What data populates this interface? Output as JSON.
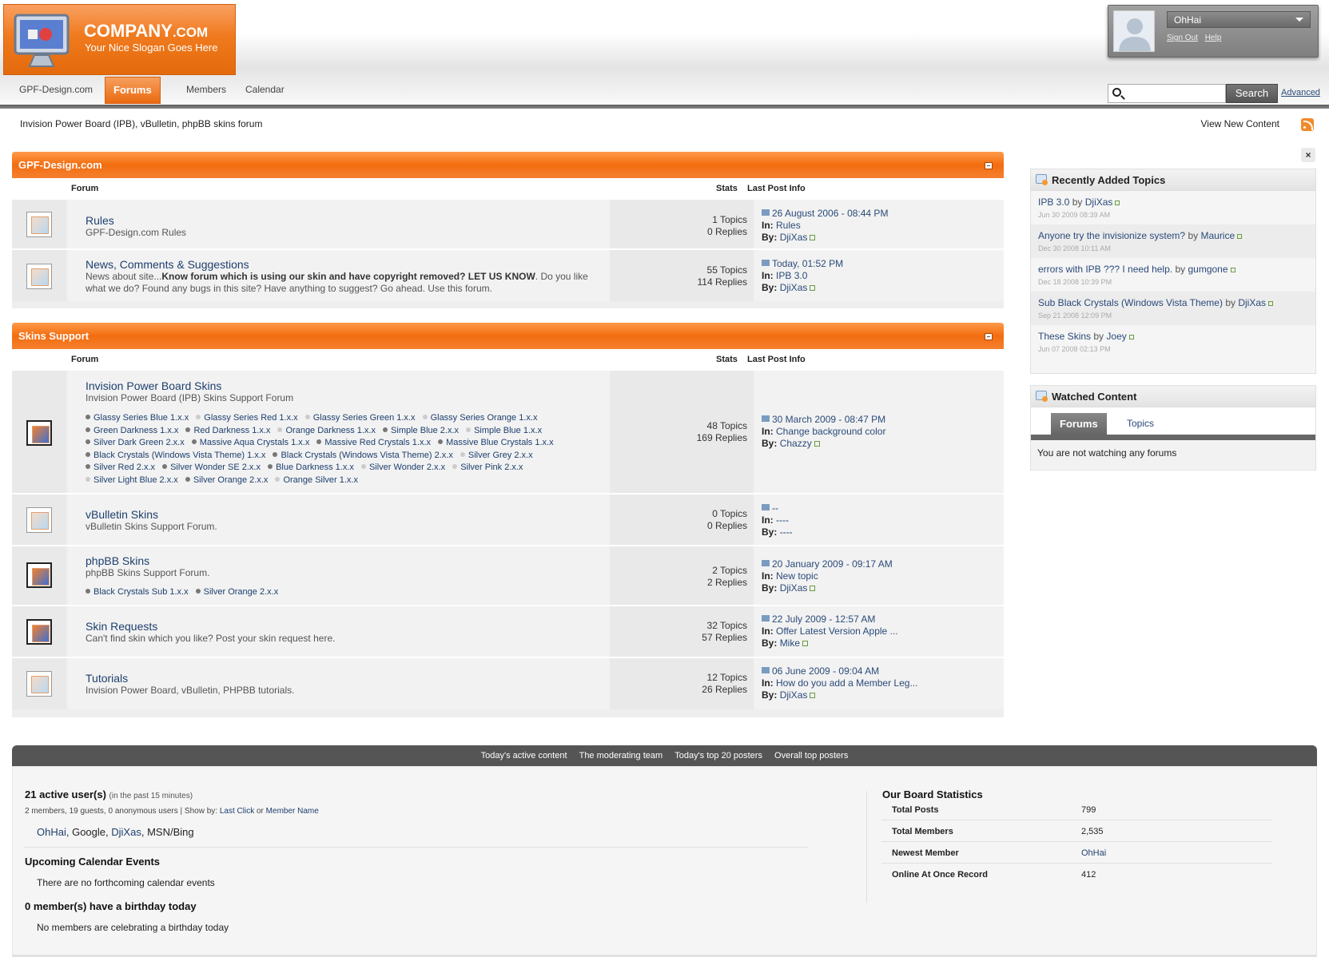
{
  "header": {
    "logo_title": "COMPANY",
    "logo_suffix": ".COM",
    "logo_slogan": "Your Nice Slogan Goes Here",
    "nav_tabs": [
      {
        "label": "GPF-Design.com"
      },
      {
        "label": "Forums",
        "active": true
      },
      {
        "label": "Members"
      },
      {
        "label": "Calendar"
      }
    ],
    "user": {
      "name": "OhHai",
      "sign_out": "Sign Out",
      "help": "Help"
    },
    "search": {
      "button": "Search",
      "advanced": "Advanced",
      "value": ""
    }
  },
  "page": {
    "title": "Invision Power Board (IPB), vBulletin, phpBB skins forum",
    "view_new_content": "View New Content"
  },
  "columns": {
    "forum": "Forum",
    "stats": "Stats",
    "last_post": "Last Post Info"
  },
  "categories": [
    {
      "title": "GPF-Design.com",
      "forums": [
        {
          "name": "Rules",
          "desc": "GPF-Design.com Rules",
          "topics": "1 Topics",
          "replies": "0 Replies",
          "last_date": "26 August 2006 - 08:44 PM",
          "last_in": "Rules",
          "last_by": "DjiXas"
        },
        {
          "name": "News, Comments & Suggestions",
          "desc_pre": "News about site...",
          "desc_bold": "Know forum which is using our skin and have copyright removed? LET US KNOW",
          "desc_post": ". Do you like what we do? Found any bugs in this site? Have anything to suggest? Go ahead. Use this forum.",
          "topics": "55 Topics",
          "replies": "114 Replies",
          "last_date": "Today, 01:52 PM",
          "last_in": "IPB 3.0",
          "last_by": "DjiXas"
        }
      ]
    },
    {
      "title": "Skins Support",
      "forums": [
        {
          "name": "Invision Power Board Skins",
          "desc": "Invision Power Board (IPB) Skins Support Forum",
          "subforums": [
            "Glassy Series Blue 1.x.x",
            "Glassy Series Red 1.x.x",
            "Glassy Series Green 1.x.x",
            "Glassy Series Orange 1.x.x",
            "Green Darkness 1.x.x",
            "Red Darkness 1.x.x",
            "Orange Darkness 1.x.x",
            "Simple Blue 2.x.x",
            "Simple Blue 1.x.x",
            "Silver Dark Green 2.x.x",
            "Massive Aqua Crystals 1.x.x",
            "Massive Red Crystals 1.x.x",
            "Massive Blue Crystals 1.x.x",
            "Black Crystals (Windows Vista Theme) 1.x.x",
            "Black Crystals (Windows Vista Theme) 2.x.x",
            "Silver Grey 2.x.x",
            "Silver Red 2.x.x",
            "Silver Wonder SE 2.x.x",
            "Blue Darkness 1.x.x",
            "Silver Wonder 2.x.x",
            "Silver Pink 2.x.x",
            "Silver Light Blue 2.x.x",
            "Silver Orange 2.x.x",
            "Orange Silver 1.x.x"
          ],
          "topics": "48 Topics",
          "replies": "169 Replies",
          "last_date": "30 March 2009 - 08:47 PM",
          "last_in": "Change background color",
          "last_by": "Chazzy"
        },
        {
          "name": "vBulletin Skins",
          "desc": "vBulletin Skins Support Forum.",
          "topics": "0 Topics",
          "replies": "0 Replies",
          "last_date": "--",
          "last_in": "----",
          "last_by": "----"
        },
        {
          "name": "phpBB Skins",
          "desc": "phpBB Skins Support Forum.",
          "subforums": [
            "Black Crystals Sub 1.x.x",
            "Silver Orange 2.x.x"
          ],
          "topics": "2 Topics",
          "replies": "2 Replies",
          "last_date": "20 January 2009 - 09:17 AM",
          "last_in": "New topic",
          "last_by": "DjiXas"
        },
        {
          "name": "Skin Requests",
          "desc": "Can't find skin which you like? Post your skin request here.",
          "topics": "32 Topics",
          "replies": "57 Replies",
          "last_date": "22 July 2009 - 12:57 AM",
          "last_in": "Offer Latest Version Apple ...",
          "last_by": "Mike"
        },
        {
          "name": "Tutorials",
          "desc": "Invision Power Board, vBulletin, PHPBB tutorials.",
          "topics": "12 Topics",
          "replies": "26 Replies",
          "last_date": "06 June 2009 - 09:04 AM",
          "last_in": "How do you add a Member Leg...",
          "last_by": "DjiXas"
        }
      ]
    }
  ],
  "labels": {
    "in": "In:",
    "by": "By:",
    "by_word": "by"
  },
  "sidebar": {
    "close": "×",
    "recent_title": "Recently Added Topics",
    "recent": [
      {
        "title": "IPB 3.0",
        "author": "DjiXas",
        "date": "Jun 30 2009 08:39 AM"
      },
      {
        "title": "Anyone try the invisionize system?",
        "author": "Maurice",
        "date": "Dec 30 2008 10:11 AM"
      },
      {
        "title": "errors with IPB ??? I need help.",
        "author": "gumgone",
        "date": "Dec 18 2008 10:39 PM"
      },
      {
        "title": "Sub Black Crystals (Windows Vista Theme)",
        "author": "DjiXas",
        "date": "Sep 21 2008 12:09 PM"
      },
      {
        "title": "These Skins",
        "author": "Joey",
        "date": "Jun 07 2008 02:13 PM"
      }
    ],
    "watched_title": "Watched Content",
    "watched_tabs": [
      "Forums",
      "Topics"
    ],
    "watched_empty": "You are not watching any forums"
  },
  "stats_bar": [
    "Today's active content",
    "The moderating team",
    "Today's top 20 posters",
    "Overall top posters"
  ],
  "active_users": {
    "heading": "21 active user(s)",
    "heading_note": "(in the past 15 minutes)",
    "summary": "2 members, 19 guests, 0 anonymous users | Show by:",
    "show_by_links": [
      "Last Click",
      "Member Name"
    ],
    "show_by_or": "or",
    "users": [
      "OhHai",
      "Google",
      "DjiXas",
      "MSN/Bing"
    ]
  },
  "calendar": {
    "heading": "Upcoming Calendar Events",
    "text": "There are no forthcoming calendar events"
  },
  "birthdays": {
    "heading": "0 member(s) have a birthday today",
    "text": "No members are celebrating a birthday today"
  },
  "board_stats": {
    "heading": "Our Board Statistics",
    "rows": [
      {
        "label": "Total Posts",
        "value": "799"
      },
      {
        "label": "Total Members",
        "value": "2,535"
      },
      {
        "label": "Newest Member",
        "value": "OhHai",
        "link": true
      },
      {
        "label": "Online At Once Record",
        "value": "412"
      }
    ]
  },
  "colors": {
    "accent": "#f26d0f",
    "link": "#1d3f6e",
    "dark_bar": "#555555"
  }
}
